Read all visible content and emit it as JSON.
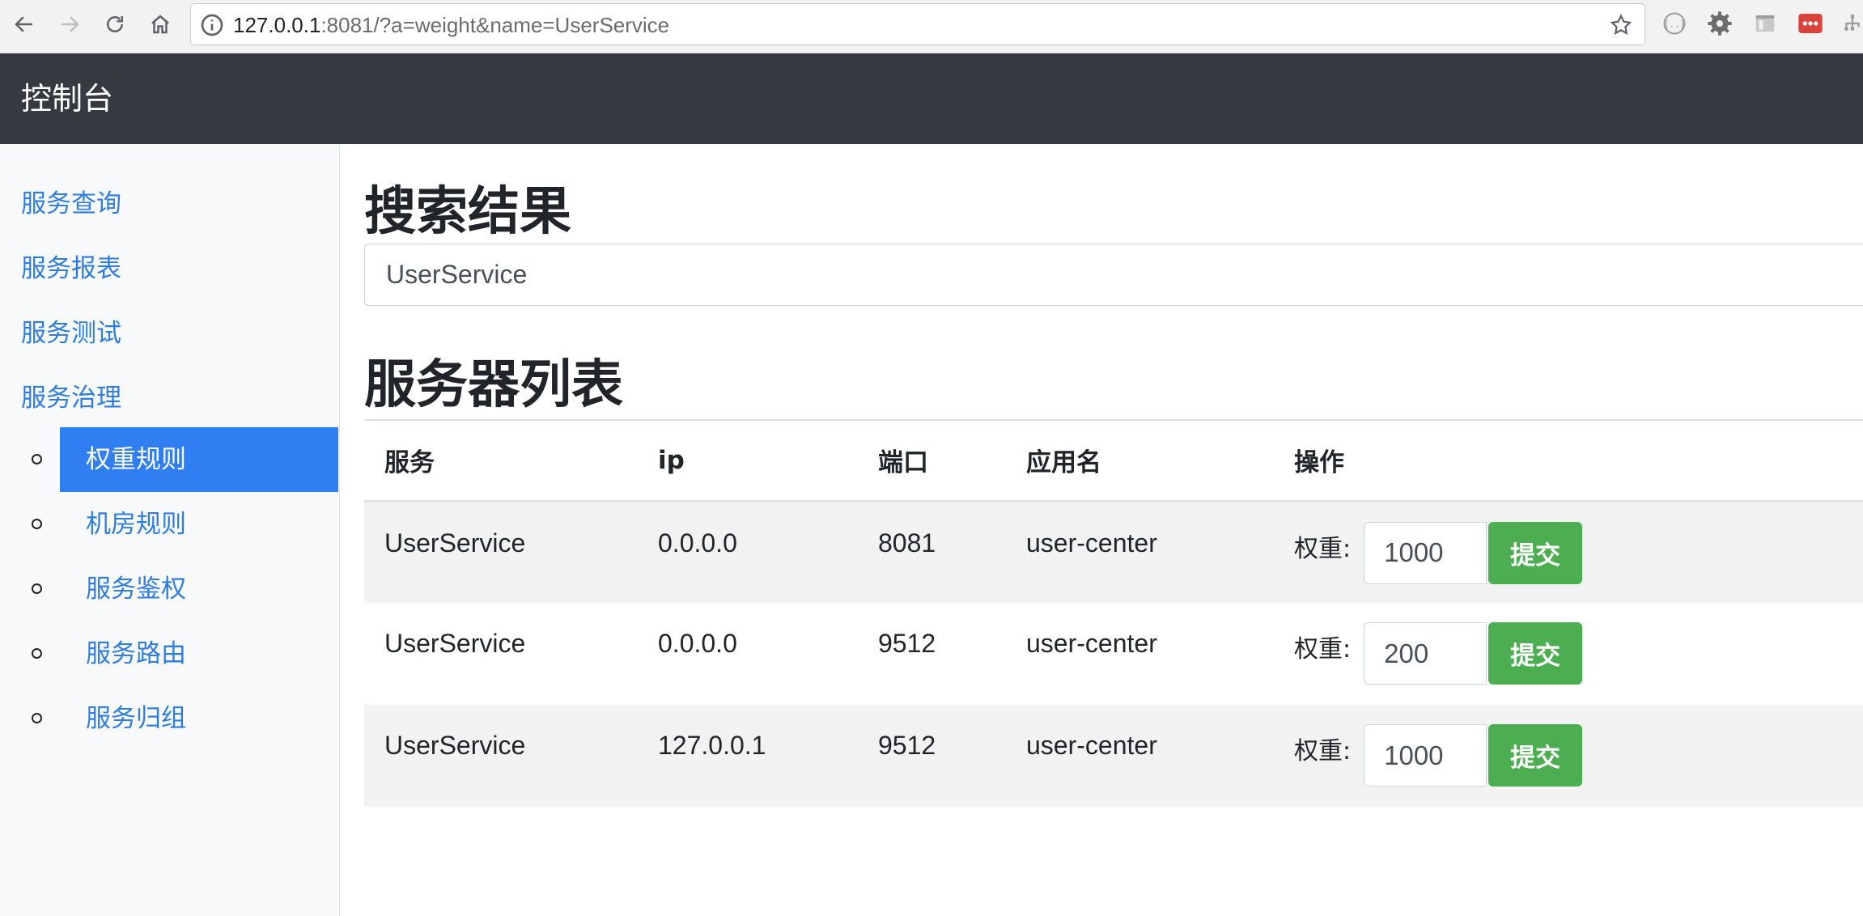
{
  "browser": {
    "url_host": "127.0.0.1",
    "url_rest": ":8081/?a=weight&name=UserService",
    "ext_colors": {
      "red": "#d9433a"
    }
  },
  "navbar": {
    "brand": "控制台"
  },
  "sidebar": {
    "items": [
      {
        "label": "服务查询"
      },
      {
        "label": "服务报表"
      },
      {
        "label": "服务测试"
      },
      {
        "label": "服务治理"
      }
    ],
    "sub_items": [
      {
        "label": "权重规则",
        "active": true
      },
      {
        "label": "机房规则",
        "active": false
      },
      {
        "label": "服务鉴权",
        "active": false
      },
      {
        "label": "服务路由",
        "active": false
      },
      {
        "label": "服务归组",
        "active": false
      }
    ]
  },
  "main": {
    "search_title": "搜索结果",
    "search_value": "UserService",
    "list_title": "服务器列表",
    "table": {
      "headers": [
        "服务",
        "ip",
        "端口",
        "应用名",
        "操作"
      ],
      "weight_label": "权重:",
      "submit_label": "提交",
      "rows": [
        {
          "service": "UserService",
          "ip": "0.0.0.0",
          "port": "8081",
          "app": "user-center",
          "weight": "1000"
        },
        {
          "service": "UserService",
          "ip": "0.0.0.0",
          "port": "9512",
          "app": "user-center",
          "weight": "200"
        },
        {
          "service": "UserService",
          "ip": "127.0.0.1",
          "port": "9512",
          "app": "user-center",
          "weight": "1000"
        }
      ]
    }
  },
  "colors": {
    "navbar": "#343a40",
    "accent": "#2f7ef2",
    "link": "#2f7de1",
    "submit": "#4cae50",
    "row_stripe": "#f2f2f2"
  }
}
